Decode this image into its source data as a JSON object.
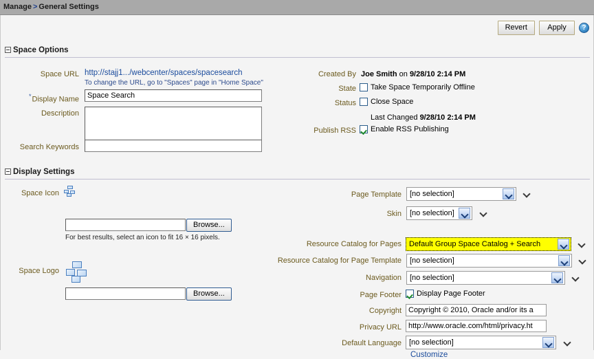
{
  "breadcrumb": {
    "root": "Manage",
    "separator": ">",
    "current": "General Settings"
  },
  "toolbar": {
    "revert_label": "Revert",
    "apply_label": "Apply",
    "help_label": "?"
  },
  "sections": {
    "space_options": {
      "title": "Space Options",
      "left": {
        "space_url_label": "Space URL",
        "space_url_value": "http://stajj1.../webcenter/spaces/spacesearch",
        "space_url_hint": "To change the URL, go to \"Spaces\" page in \"Home Space\"",
        "display_name_label": "Display Name",
        "display_name_required": "*",
        "display_name_value": "Space Search",
        "description_label": "Description",
        "description_value": "",
        "search_keywords_label": "Search Keywords",
        "search_keywords_value": ""
      },
      "right": {
        "created_by_label": "Created By",
        "created_by_name": "Joe Smith",
        "created_by_mid": " on ",
        "created_by_date": "9/28/10 2:14 PM",
        "state_label": "State",
        "state_checkbox_label": "Take Space Temporarily Offline",
        "state_checked": false,
        "status_label": "Status",
        "status_checkbox_label": "Close Space",
        "status_checked": false,
        "last_changed_label": "Last Changed",
        "last_changed_value": "9/28/10 2:14 PM",
        "publish_rss_label": "Publish RSS",
        "publish_rss_checkbox_label": "Enable RSS Publishing",
        "publish_rss_checked": true
      }
    },
    "display_settings": {
      "title": "Display Settings",
      "left": {
        "space_icon_label": "Space Icon",
        "space_icon_file_value": "",
        "space_icon_browse_label": "Browse...",
        "space_icon_hint": "For best results, select an icon to fit 16 × 16 pixels.",
        "space_logo_label": "Space Logo",
        "space_logo_file_value": "",
        "space_logo_browse_label": "Browse..."
      },
      "right": {
        "page_template_label": "Page Template",
        "page_template_value": "[no selection]",
        "skin_label": "Skin",
        "skin_value": "[no selection]",
        "catalog_pages_label": "Resource Catalog for Pages",
        "catalog_pages_value": "Default Group Space Catalog + Search",
        "catalog_template_label": "Resource Catalog for Page Template",
        "catalog_template_value": "[no selection]",
        "navigation_label": "Navigation",
        "navigation_value": "[no selection]",
        "page_footer_label": "Page Footer",
        "page_footer_checkbox_label": "Display Page Footer",
        "page_footer_checked": true,
        "copyright_label": "Copyright",
        "copyright_value": "Copyright © 2010, Oracle and/or its a",
        "privacy_url_label": "Privacy URL",
        "privacy_url_value": "http://www.oracle.com/html/privacy.ht",
        "default_language_label": "Default Language",
        "default_language_value": "[no selection]",
        "customize_link": "Customize"
      }
    }
  },
  "colors": {
    "header_bar": "#a9a9a9",
    "label_text": "#6b5a1e",
    "link_text": "#1a4b9c",
    "highlight": "#ffff00",
    "page_bg": "#f4f4f4"
  }
}
